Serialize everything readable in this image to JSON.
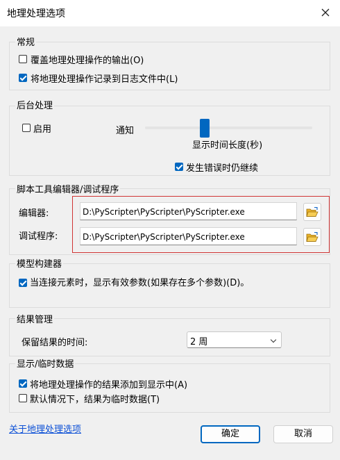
{
  "window": {
    "title": "地理处理选项"
  },
  "general": {
    "title": "常规",
    "overwrite_label": "覆盖地理处理操作的输出(O)",
    "overwrite_checked": false,
    "log_label": "将地理处理操作记录到日志文件中(L)",
    "log_checked": true
  },
  "background": {
    "title": "后台处理",
    "enable_label": "启用",
    "enable_checked": false,
    "notify_label": "通知",
    "duration_label": "显示时间长度(秒)",
    "continue_label": "发生错误时仍继续",
    "continue_checked": true
  },
  "script": {
    "title": "脚本工具编辑器/调试程序",
    "editor_label": "编辑器:",
    "editor_value": "D:\\PyScripter\\PyScripter\\PyScripter.exe",
    "debugger_label": "调试程序:",
    "debugger_value": "D:\\PyScripter\\PyScripter\\PyScripter.exe"
  },
  "modelbuilder": {
    "title": "模型构建器",
    "connect_label": "当连接元素时，显示有效参数(如果存在多个参数)(D)。",
    "connect_checked": true
  },
  "results": {
    "title": "结果管理",
    "keep_label": "保留结果的时间:",
    "keep_value": "2 周"
  },
  "display": {
    "title": "显示/临时数据",
    "add_label": "将地理处理操作的结果添加到显示中(A)",
    "add_checked": true,
    "temp_label": "默认情况下，结果为临时数据(T)",
    "temp_checked": false
  },
  "footer": {
    "about_link": "关于地理处理选项",
    "ok_label": "确定",
    "cancel_label": "取消"
  },
  "colors": {
    "accent": "#0067c0",
    "highlight_border": "#d03434",
    "link": "#0b4fd6"
  }
}
